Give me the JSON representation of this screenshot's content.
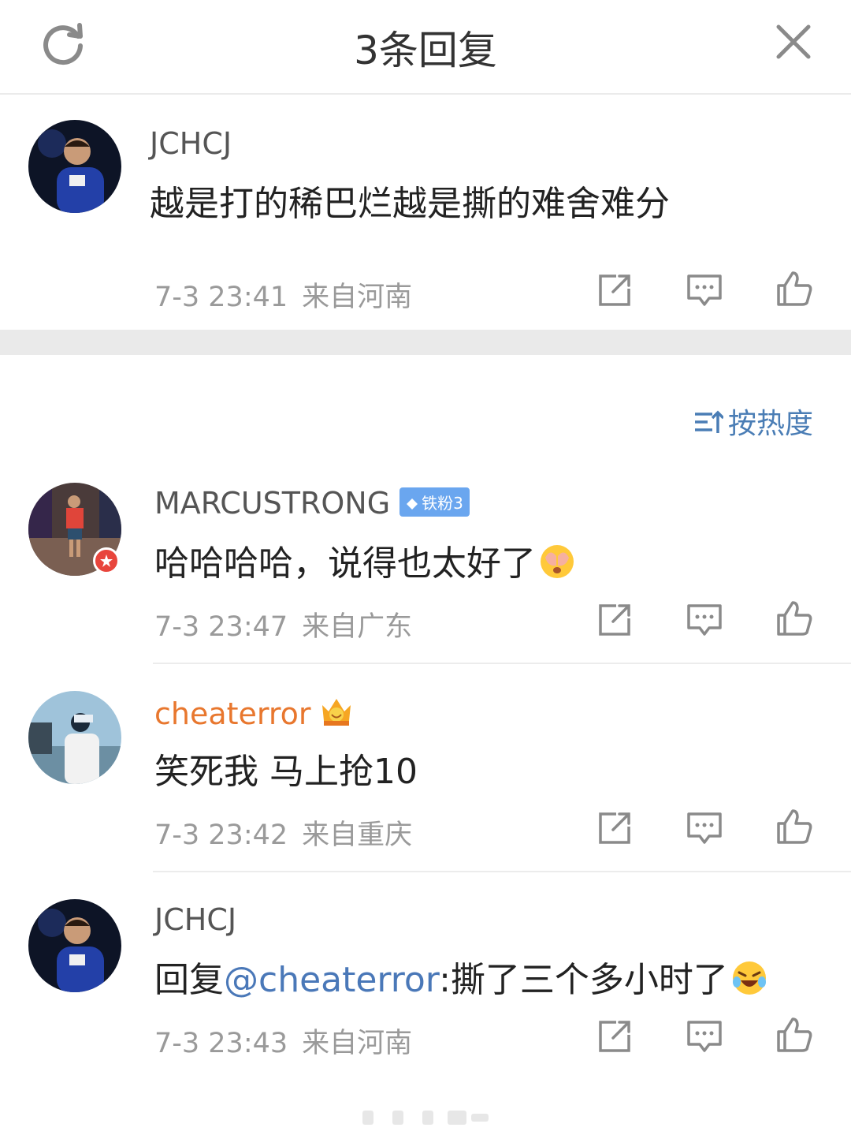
{
  "header": {
    "title": "3条回复",
    "refresh_icon": "refresh-icon",
    "close_icon": "close-icon"
  },
  "main_comment": {
    "username": "JCHCJ",
    "text": "越是打的稀巴烂越是撕的难舍难分",
    "time": "7-3 23:41",
    "location": "来自河南"
  },
  "sort": {
    "label": "按热度",
    "icon": "sort-icon"
  },
  "replies": [
    {
      "username": "MARCUSTRONG",
      "badge": "铁粉3",
      "text": "哈哈哈哈，说得也太好了",
      "emoji": "shy-face-emoji",
      "time": "7-3 23:47",
      "location": "来自广东"
    },
    {
      "username": "cheaterror",
      "badge_icon": "crown-icon",
      "text": "笑死我 马上抢10",
      "time": "7-3 23:42",
      "location": "来自重庆"
    },
    {
      "username": "JCHCJ",
      "text_prefix": "回复",
      "mention": "@cheaterror",
      "text_suffix": ":撕了三个多小时了",
      "emoji": "laughing-crying-emoji",
      "time": "7-3 23:43",
      "location": "来自河南"
    }
  ],
  "colors": {
    "accent_blue": "#4a7db5",
    "username_orange": "#e8772e",
    "meta_gray": "#9a9a9a",
    "badge_blue": "#6aa6ef",
    "band_gray": "#eaeaea"
  }
}
